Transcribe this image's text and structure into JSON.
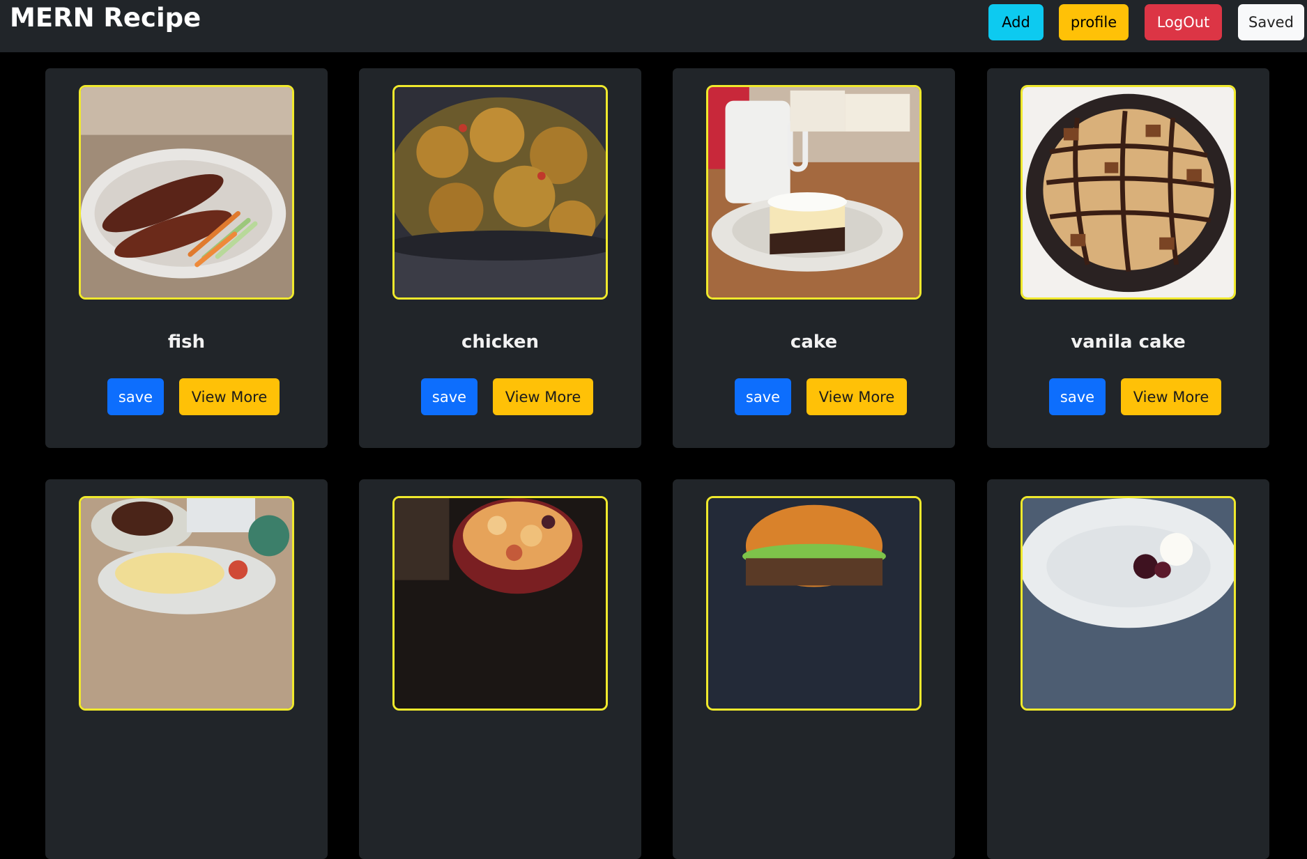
{
  "app": {
    "title": "MERN Recipe"
  },
  "nav": {
    "add_label": "Add",
    "profile_label": "profile",
    "logout_label": "LogOut",
    "saved_label": "Saved"
  },
  "recipes": [
    {
      "title": "fish",
      "save_label": "save",
      "view_label": "View More",
      "image": "fish-plate-image"
    },
    {
      "title": "chicken",
      "save_label": "save",
      "view_label": "View More",
      "image": "chicken-pan-image"
    },
    {
      "title": "cake",
      "save_label": "save",
      "view_label": "View More",
      "image": "cake-slice-image"
    },
    {
      "title": "vanila cake",
      "save_label": "save",
      "view_label": "View More",
      "image": "chocolate-pie-image"
    },
    {
      "image": "plated-meal-image"
    },
    {
      "image": "bread-pudding-image"
    },
    {
      "image": "burger-image"
    },
    {
      "image": "dessert-bowl-image"
    }
  ],
  "colors": {
    "navbar": "#212529",
    "card": "#212529",
    "image_border": "#f0e92c",
    "save": "#0d6efd",
    "view_more": "#ffc107",
    "add": "#0dcaf0",
    "logout": "#dc3545"
  }
}
